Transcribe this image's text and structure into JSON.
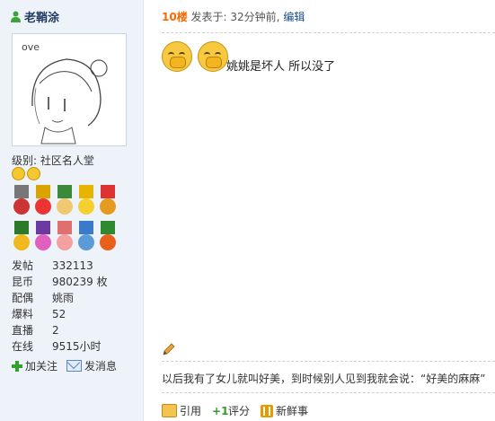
{
  "user": {
    "name": "老鞘涂",
    "level_label": "级别:",
    "level_value": "社区名人堂",
    "stats": [
      {
        "label": "发帖",
        "value": "332113"
      },
      {
        "label": "昆币",
        "value": "980239 枚"
      },
      {
        "label": "配偶",
        "value": "姚雨"
      },
      {
        "label": "爆料",
        "value": "52"
      },
      {
        "label": "直播",
        "value": "2"
      },
      {
        "label": "在线",
        "value": "9515小时"
      }
    ],
    "add_follow": "加关注",
    "send_message": "发消息",
    "avatar_text": "ove"
  },
  "post": {
    "floor": "10楼",
    "posted_prefix": "发表于: ",
    "time_ago": "32分钟前",
    "separator": ", ",
    "edit_label": "编辑",
    "body": "姚姚是坏人  所以没了",
    "signature": "以后我有了女儿就叫好美，到时候别人见到我就会说：“好美的麻麻”"
  },
  "actions": {
    "quote": "引用",
    "rate": "评分",
    "news": "新鲜事"
  },
  "colors": {
    "floor": "#ff6600",
    "link": "#1a4c8a",
    "sidebar_bg": "#eef3f9"
  }
}
